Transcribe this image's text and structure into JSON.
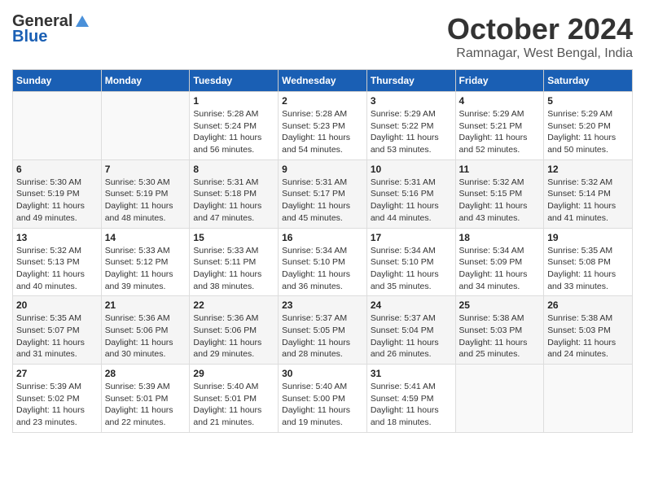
{
  "logo": {
    "line1": "General",
    "line2": "Blue"
  },
  "title": "October 2024",
  "location": "Ramnagar, West Bengal, India",
  "headers": [
    "Sunday",
    "Monday",
    "Tuesday",
    "Wednesday",
    "Thursday",
    "Friday",
    "Saturday"
  ],
  "weeks": [
    [
      {
        "day": "",
        "info": ""
      },
      {
        "day": "",
        "info": ""
      },
      {
        "day": "1",
        "info": "Sunrise: 5:28 AM\nSunset: 5:24 PM\nDaylight: 11 hours and 56 minutes."
      },
      {
        "day": "2",
        "info": "Sunrise: 5:28 AM\nSunset: 5:23 PM\nDaylight: 11 hours and 54 minutes."
      },
      {
        "day": "3",
        "info": "Sunrise: 5:29 AM\nSunset: 5:22 PM\nDaylight: 11 hours and 53 minutes."
      },
      {
        "day": "4",
        "info": "Sunrise: 5:29 AM\nSunset: 5:21 PM\nDaylight: 11 hours and 52 minutes."
      },
      {
        "day": "5",
        "info": "Sunrise: 5:29 AM\nSunset: 5:20 PM\nDaylight: 11 hours and 50 minutes."
      }
    ],
    [
      {
        "day": "6",
        "info": "Sunrise: 5:30 AM\nSunset: 5:19 PM\nDaylight: 11 hours and 49 minutes."
      },
      {
        "day": "7",
        "info": "Sunrise: 5:30 AM\nSunset: 5:19 PM\nDaylight: 11 hours and 48 minutes."
      },
      {
        "day": "8",
        "info": "Sunrise: 5:31 AM\nSunset: 5:18 PM\nDaylight: 11 hours and 47 minutes."
      },
      {
        "day": "9",
        "info": "Sunrise: 5:31 AM\nSunset: 5:17 PM\nDaylight: 11 hours and 45 minutes."
      },
      {
        "day": "10",
        "info": "Sunrise: 5:31 AM\nSunset: 5:16 PM\nDaylight: 11 hours and 44 minutes."
      },
      {
        "day": "11",
        "info": "Sunrise: 5:32 AM\nSunset: 5:15 PM\nDaylight: 11 hours and 43 minutes."
      },
      {
        "day": "12",
        "info": "Sunrise: 5:32 AM\nSunset: 5:14 PM\nDaylight: 11 hours and 41 minutes."
      }
    ],
    [
      {
        "day": "13",
        "info": "Sunrise: 5:32 AM\nSunset: 5:13 PM\nDaylight: 11 hours and 40 minutes."
      },
      {
        "day": "14",
        "info": "Sunrise: 5:33 AM\nSunset: 5:12 PM\nDaylight: 11 hours and 39 minutes."
      },
      {
        "day": "15",
        "info": "Sunrise: 5:33 AM\nSunset: 5:11 PM\nDaylight: 11 hours and 38 minutes."
      },
      {
        "day": "16",
        "info": "Sunrise: 5:34 AM\nSunset: 5:10 PM\nDaylight: 11 hours and 36 minutes."
      },
      {
        "day": "17",
        "info": "Sunrise: 5:34 AM\nSunset: 5:10 PM\nDaylight: 11 hours and 35 minutes."
      },
      {
        "day": "18",
        "info": "Sunrise: 5:34 AM\nSunset: 5:09 PM\nDaylight: 11 hours and 34 minutes."
      },
      {
        "day": "19",
        "info": "Sunrise: 5:35 AM\nSunset: 5:08 PM\nDaylight: 11 hours and 33 minutes."
      }
    ],
    [
      {
        "day": "20",
        "info": "Sunrise: 5:35 AM\nSunset: 5:07 PM\nDaylight: 11 hours and 31 minutes."
      },
      {
        "day": "21",
        "info": "Sunrise: 5:36 AM\nSunset: 5:06 PM\nDaylight: 11 hours and 30 minutes."
      },
      {
        "day": "22",
        "info": "Sunrise: 5:36 AM\nSunset: 5:06 PM\nDaylight: 11 hours and 29 minutes."
      },
      {
        "day": "23",
        "info": "Sunrise: 5:37 AM\nSunset: 5:05 PM\nDaylight: 11 hours and 28 minutes."
      },
      {
        "day": "24",
        "info": "Sunrise: 5:37 AM\nSunset: 5:04 PM\nDaylight: 11 hours and 26 minutes."
      },
      {
        "day": "25",
        "info": "Sunrise: 5:38 AM\nSunset: 5:03 PM\nDaylight: 11 hours and 25 minutes."
      },
      {
        "day": "26",
        "info": "Sunrise: 5:38 AM\nSunset: 5:03 PM\nDaylight: 11 hours and 24 minutes."
      }
    ],
    [
      {
        "day": "27",
        "info": "Sunrise: 5:39 AM\nSunset: 5:02 PM\nDaylight: 11 hours and 23 minutes."
      },
      {
        "day": "28",
        "info": "Sunrise: 5:39 AM\nSunset: 5:01 PM\nDaylight: 11 hours and 22 minutes."
      },
      {
        "day": "29",
        "info": "Sunrise: 5:40 AM\nSunset: 5:01 PM\nDaylight: 11 hours and 21 minutes."
      },
      {
        "day": "30",
        "info": "Sunrise: 5:40 AM\nSunset: 5:00 PM\nDaylight: 11 hours and 19 minutes."
      },
      {
        "day": "31",
        "info": "Sunrise: 5:41 AM\nSunset: 4:59 PM\nDaylight: 11 hours and 18 minutes."
      },
      {
        "day": "",
        "info": ""
      },
      {
        "day": "",
        "info": ""
      }
    ]
  ]
}
